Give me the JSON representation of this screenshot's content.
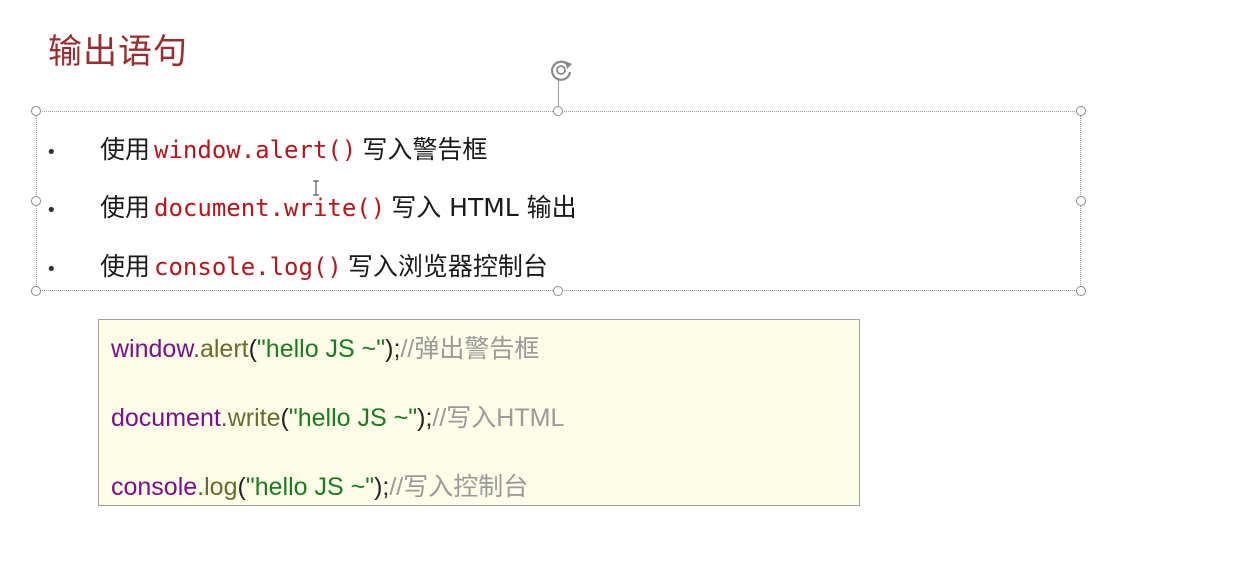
{
  "slide": {
    "title": "输出语句"
  },
  "bullets": [
    {
      "prefix": "使用",
      "code": "window.alert()",
      "suffix": "写入警告框"
    },
    {
      "prefix": "使用",
      "code": "document.write()",
      "suffix": "写入 HTML 输出"
    },
    {
      "prefix": "使用",
      "code": "console.log()",
      "suffix": "写入浏览器控制台"
    }
  ],
  "bullet_char": "•",
  "code_sample": {
    "lines": [
      {
        "object": "window",
        "dot": ".",
        "method": "alert",
        "open": "(",
        "string": "\"hello JS ~\"",
        "close": ");",
        "comment": "//弹出警告框"
      },
      {
        "object": "document",
        "dot": ".",
        "method": "write",
        "open": "(",
        "string": "\"hello JS ~\"",
        "close": ");",
        "comment": "//写入HTML"
      },
      {
        "object": "console",
        "dot": ".",
        "method": "log",
        "open": "(",
        "string": "\"hello JS ~\"",
        "close": ");",
        "comment": "//写入控制台"
      }
    ]
  },
  "colors": {
    "title": "#9b2d30",
    "inline_code": "#b5161c",
    "code_object": "#7a0f8a",
    "code_method": "#6b6b2e",
    "code_string": "#1f7a1f",
    "code_comment": "#9a9a9a",
    "code_panel_bg": "#fdfde8"
  },
  "icons": {
    "rotate_handle": "rotate-icon",
    "text_cursor": "i-beam-cursor-icon"
  }
}
